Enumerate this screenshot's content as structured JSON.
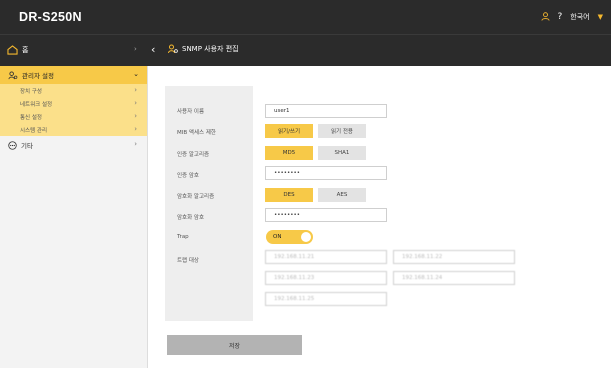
{
  "app": {
    "title": "DR-S250N"
  },
  "topbar": {
    "language": "한국어"
  },
  "subbar": {
    "home_label": "홈",
    "page_title": "SNMP 사용자 편집"
  },
  "sidebar": {
    "main": "관리자 설정",
    "items": [
      "장치 구성",
      "네트워크 설정",
      "통신 설정",
      "시스템 관리"
    ],
    "other": "기타"
  },
  "form": {
    "username_label": "사용자 이름",
    "username_value": "user1",
    "mib_label": "MIB 액세스 제한",
    "mib_options": [
      "읽기/쓰기",
      "읽기 전용"
    ],
    "mib_selected": "읽기/쓰기",
    "auth_algo_label": "인증 알고리즘",
    "auth_algo_options": [
      "MD5",
      "SHA1"
    ],
    "auth_algo_selected": "MD5",
    "auth_pw_label": "인증 암호",
    "auth_pw_value": "••••••••",
    "enc_algo_label": "암호화 알고리즘",
    "enc_algo_options": [
      "DES",
      "AES"
    ],
    "enc_algo_selected": "DES",
    "enc_pw_label": "암호화 암호",
    "enc_pw_value": "••••••••",
    "trap_label": "Trap",
    "trap_value": "ON",
    "trap_target_label": "트랩 대상",
    "trap_targets": [
      "192.168.11.21",
      "192.168.11.22",
      "192.168.11.23",
      "192.168.11.24",
      "192.168.11.25"
    ]
  },
  "save_label": "저장",
  "colors": {
    "accent": "#f7c948",
    "topbar": "#2b2b2b",
    "sidebar_sub": "#fbe08a"
  }
}
